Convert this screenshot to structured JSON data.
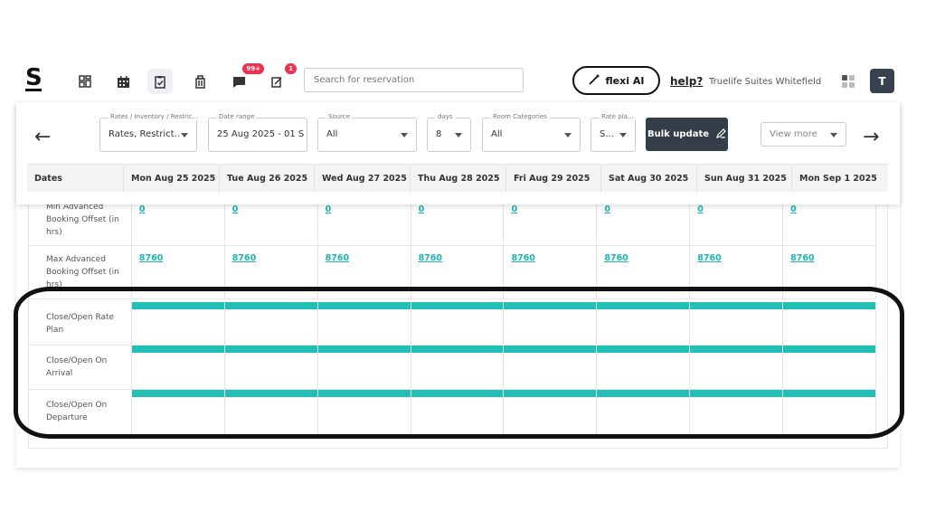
{
  "app": {
    "logo": "S",
    "hotel_name": "Truelife Suites Whitefield",
    "help_label": "help?",
    "flexi_label": "flexi AI",
    "avatar_initial": "T"
  },
  "nav": {
    "icons": [
      "dashboard-icon",
      "calendar-icon",
      "clipboard-check-icon",
      "luggage-icon",
      "chat-icon",
      "notes-icon"
    ],
    "chat_badge": "99+",
    "notes_badge": "1"
  },
  "search": {
    "placeholder": "Search for reservation"
  },
  "filters": {
    "rates": {
      "label": "Rates / Inventory / Restric...",
      "value": "Rates, Restrict..."
    },
    "date_range": {
      "label": "Date range",
      "value": "25 Aug 2025 - 01 Se"
    },
    "source": {
      "label": "Source",
      "value": "All"
    },
    "days": {
      "label": "days",
      "value": "8"
    },
    "room_categories": {
      "label": "Room Categories",
      "value": "All"
    },
    "rate_plan": {
      "label": "Rate pla...",
      "value": "S..."
    },
    "bulk_update": "Bulk update",
    "view_more": "View more"
  },
  "table": {
    "dates_header": "Dates",
    "dates": [
      "Mon Aug 25 2025",
      "Tue Aug 26 2025",
      "Wed Aug 27 2025",
      "Thu Aug 28 2025",
      "Fri Aug 29 2025",
      "Sat Aug 30 2025",
      "Sun Aug 31 2025",
      "Mon Sep 1 2025"
    ],
    "rows": [
      {
        "label": "Min Advanced Booking Offset (in hrs)",
        "values": [
          "0",
          "0",
          "0",
          "0",
          "0",
          "0",
          "0",
          "0"
        ]
      },
      {
        "label": "Max Advanced Booking Offset (in hrs)",
        "values": [
          "8760",
          "8760",
          "8760",
          "8760",
          "8760",
          "8760",
          "8760",
          "8760"
        ]
      },
      {
        "label": "Close/Open Rate Plan",
        "values": []
      },
      {
        "label": "Close/Open On Arrival",
        "values": []
      },
      {
        "label": "Close/Open On Departure",
        "values": []
      }
    ]
  },
  "colors": {
    "toggle_bar": "#22bfb6",
    "link": "#1bb5b0",
    "dark_button": "#343d48"
  }
}
